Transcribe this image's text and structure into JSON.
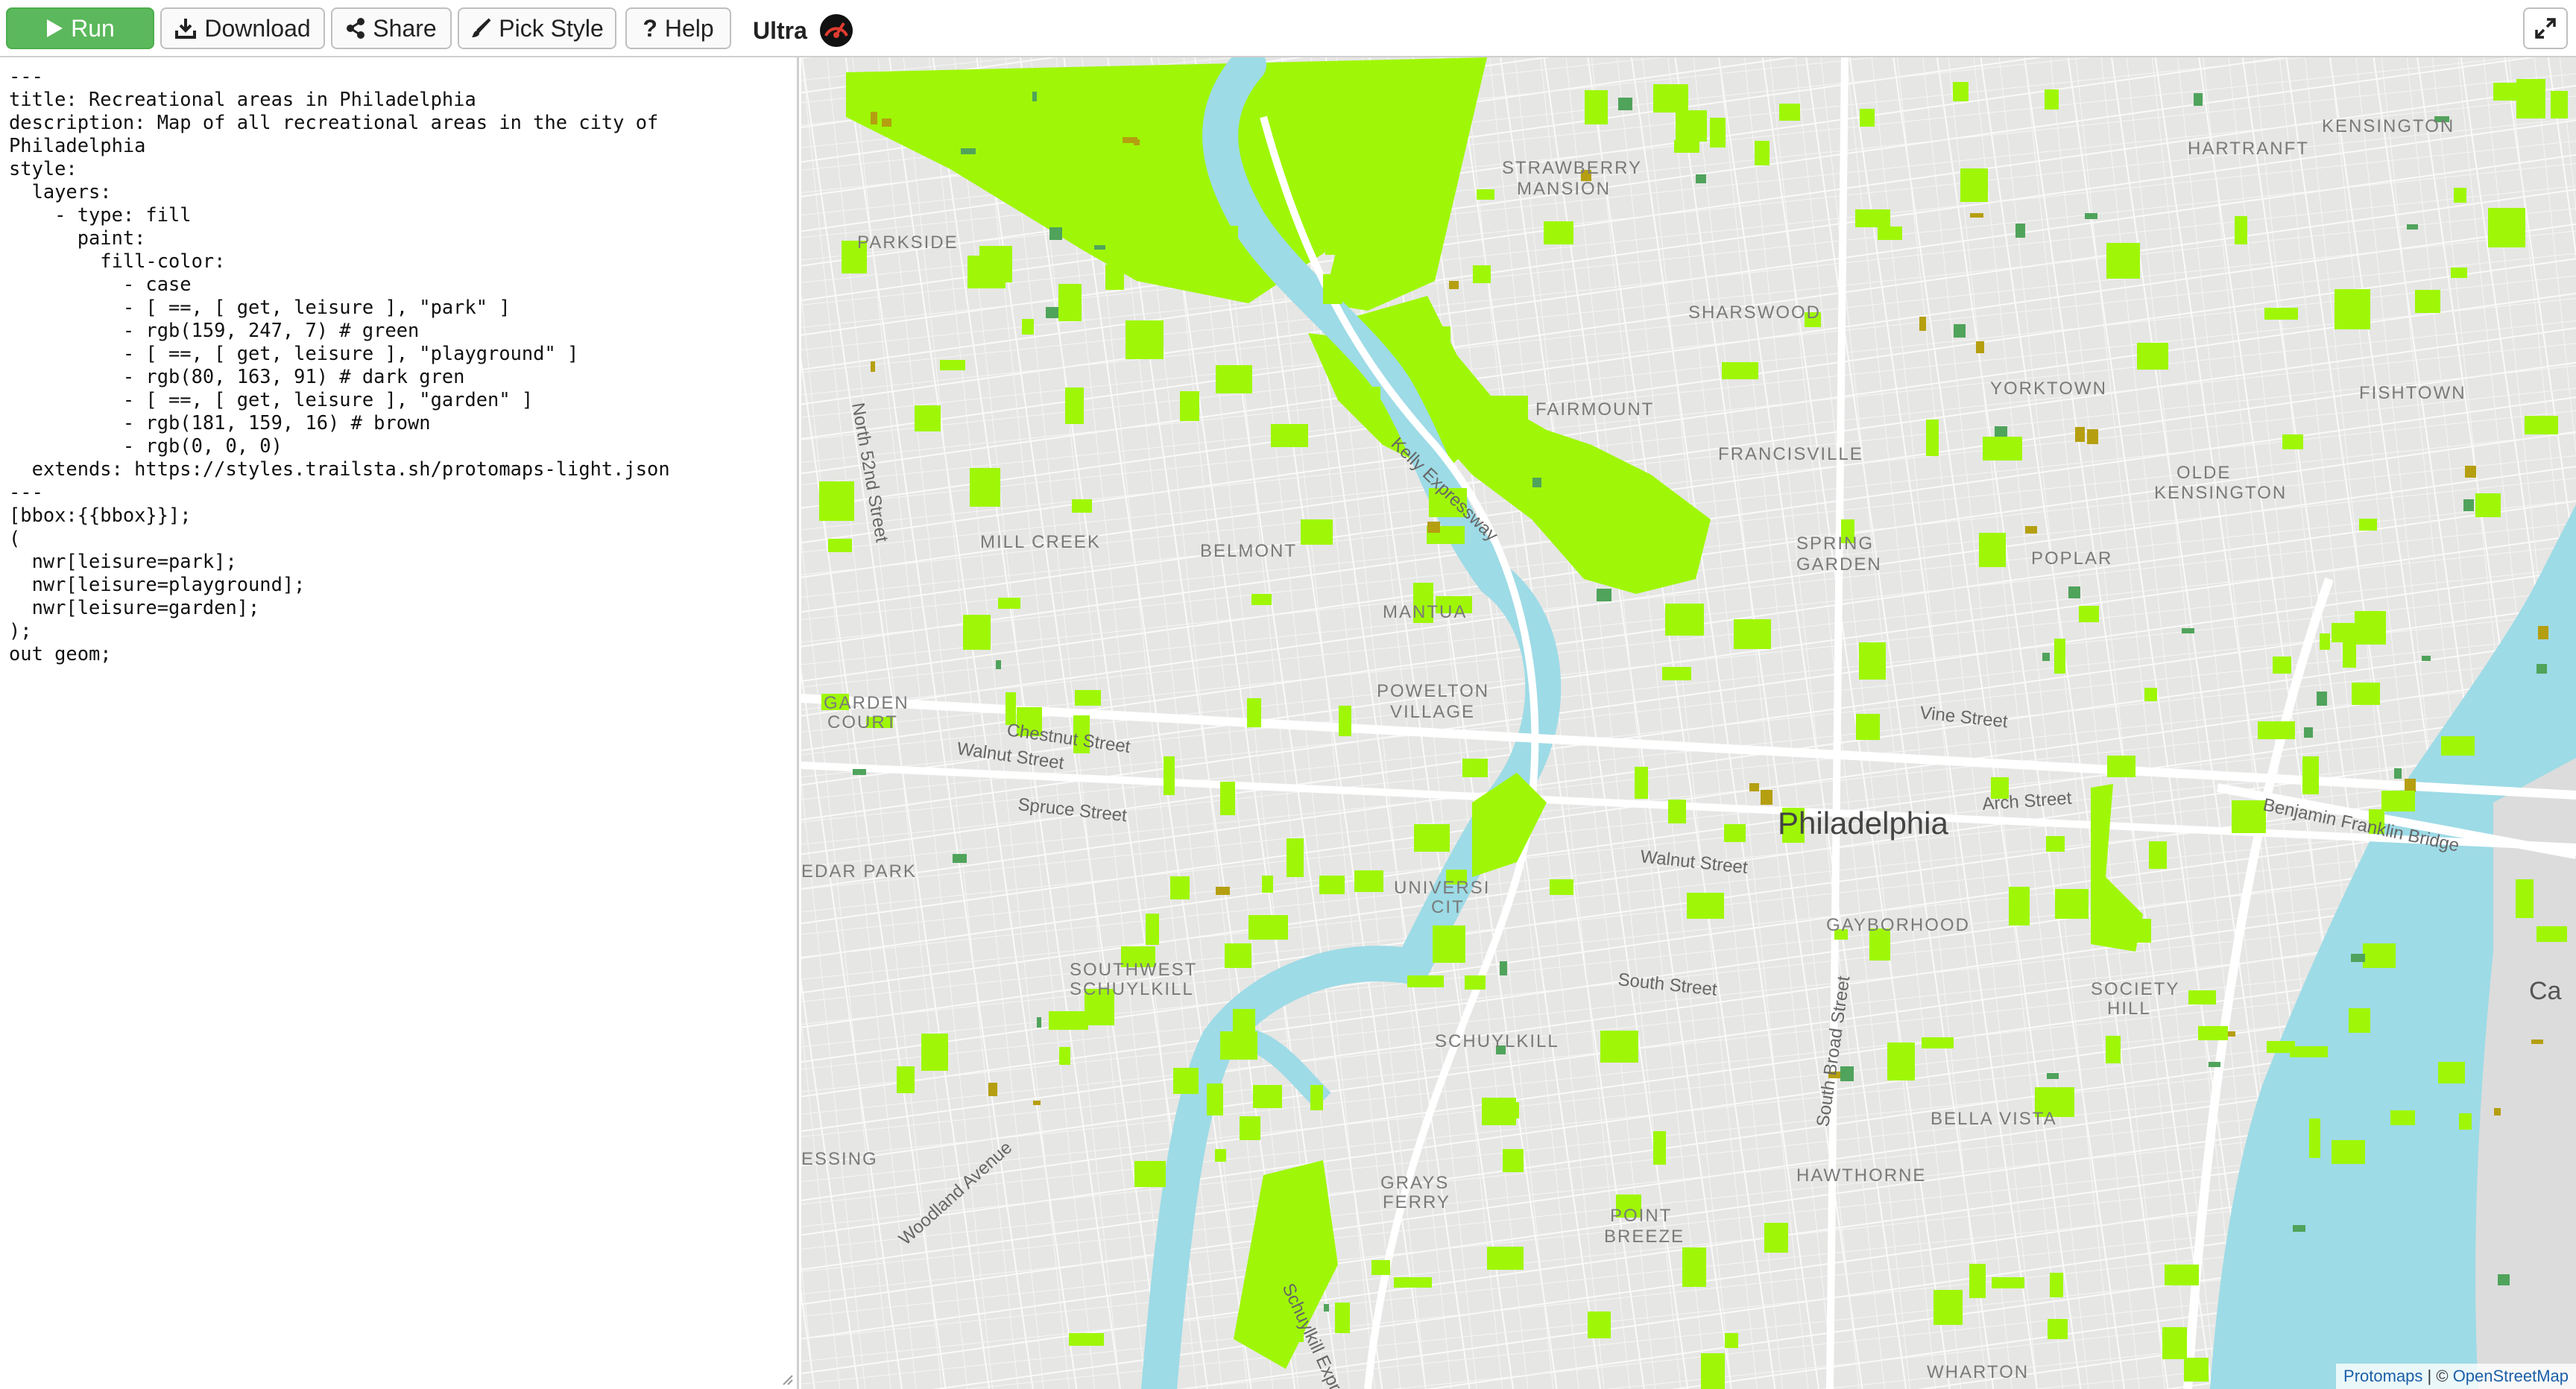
{
  "toolbar": {
    "run_label": "Run",
    "download_label": "Download",
    "share_label": "Share",
    "pick_style_label": "Pick Style",
    "help_label": "Help",
    "brand": "Ultra"
  },
  "editor": {
    "lines": [
      "---",
      "title: Recreational areas in Philadelphia",
      "description: Map of all recreational areas in the city of",
      "Philadelphia",
      "style:",
      "  layers:",
      "    - type: fill",
      "      paint:",
      "        fill-color:",
      "          - case",
      "          - [ ==, [ get, leisure ], \"park\" ]",
      "          - rgb(159, 247, 7) # green",
      "          - [ ==, [ get, leisure ], \"playground\" ]",
      "          - rgb(80, 163, 91) # dark gren",
      "          - [ ==, [ get, leisure ], \"garden\" ]",
      "          - rgb(181, 159, 16) # brown",
      "          - rgb(0, 0, 0)",
      "  extends: https://styles.trailsta.sh/protomaps-light.json",
      "---",
      "[bbox:{{bbox}}];",
      "(",
      "  nwr[leisure=park];",
      "  nwr[leisure=playground];",
      "  nwr[leisure=garden];",
      ");",
      "out geom;"
    ]
  },
  "map": {
    "colors": {
      "park": "#9ff707",
      "playground": "#50a35b",
      "garden": "#b59f10",
      "water": "#9ddbe6",
      "land": "#e6e6e4"
    },
    "city_label": "Philadelphia",
    "neighborhoods": {
      "kensington": "KENSINGTON",
      "hartranft": "HARTRANFT",
      "strawberry_mansion_1": "STRAWBERRY",
      "strawberry_mansion_2": "MANSION",
      "parkside": "PARKSIDE",
      "sharswood": "SHARSWOOD",
      "yorktown": "YORKTOWN",
      "fishtown": "FISHTOWN",
      "fairmount": "FAIRMOUNT",
      "francisville": "FRANCISVILLE",
      "olde_kensington_1": "OLDE",
      "olde_kensington_2": "KENSINGTON",
      "mill_creek": "MILL CREEK",
      "belmont": "BELMONT",
      "spring_garden_1": "SPRING",
      "spring_garden_2": "GARDEN",
      "poplar": "POPLAR",
      "mantua": "MANTUA",
      "powelton_village_1": "POWELTON",
      "powelton_village_2": "VILLAGE",
      "garden_court_1": "GARDEN",
      "garden_court_2": "COURT",
      "cedar_park": "EDAR PARK",
      "university_city_1": "UNIVERSI",
      "university_city_2": "CIT",
      "gayborhood": "GAYBORHOOD",
      "southwest_schuylkill_1": "SOUTHWEST",
      "southwest_schuylkill_2": "SCHUYLKILL",
      "society_hill_1": "SOCIETY",
      "society_hill_2": "HILL",
      "schuylkill": "SCHUYLKILL",
      "bella_vista": "BELLA VISTA",
      "kingsessing": "ESSING",
      "hawthorne": "HAWTHORNE",
      "grays_ferry_1": "GRAYS",
      "grays_ferry_2": "FERRY",
      "point_breeze_1": "POINT",
      "point_breeze_2": "BREEZE",
      "whitman": "WHARTON",
      "camden": "Ca"
    },
    "streets": {
      "north_52nd": "North 52nd Street",
      "kelly_expressway": "Kelly Expressway",
      "chestnut": "Chestnut Street",
      "walnut_west": "Walnut Street",
      "spruce": "Spruce Street",
      "walnut_center": "Walnut Street",
      "vine": "Vine Street",
      "arch": "Arch Street",
      "ben_franklin": "Benjamin Franklin Bridge",
      "south": "South Street",
      "south_broad": "South Broad Street",
      "woodland": "Woodland Avenue",
      "schuylkill_expressway": "Schuylkill Expressway"
    },
    "attribution": {
      "protomaps": "Protomaps",
      "separator": " | © ",
      "osm": "OpenStreetMap"
    }
  }
}
